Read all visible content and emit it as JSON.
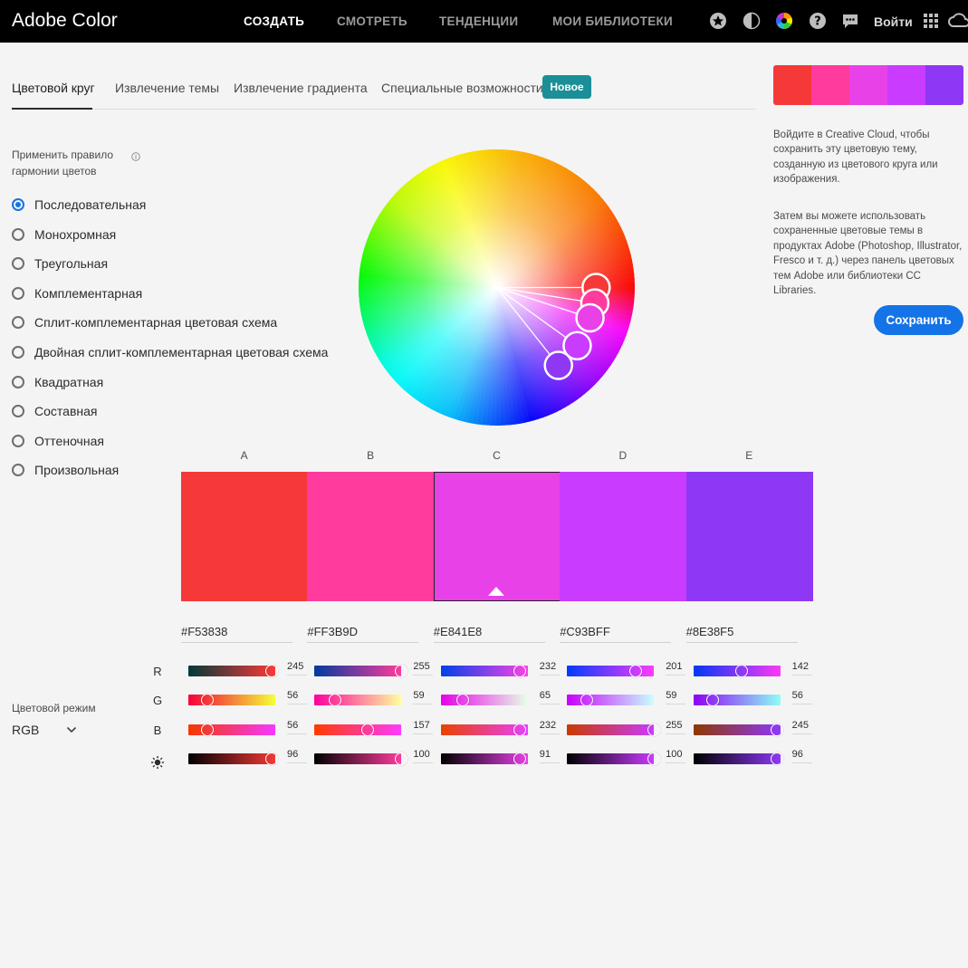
{
  "app": {
    "brand": "Adobe Color"
  },
  "nav": {
    "items": [
      "СОЗДАТЬ",
      "СМОТРЕТЬ",
      "ТЕНДЕНЦИИ",
      "МОИ БИБЛИОТЕКИ"
    ],
    "icons": [
      "star-icon",
      "contrast-icon",
      "color-wheel-icon",
      "help-icon",
      "feedback-icon"
    ],
    "login": "Войти"
  },
  "tabs": {
    "items": [
      "Цветовой круг",
      "Извлечение темы",
      "Извлечение градиента",
      "Специальные возможности"
    ],
    "badge": "Новое"
  },
  "harmony": {
    "title": "Применить правило гармонии цветов",
    "selected": 0,
    "options": [
      "Последовательная",
      "Монохромная",
      "Треугольная",
      "Комплементарная",
      "Сплит-комплементарная цветовая схема",
      "Двойная сплит-комплементарная цветовая схема",
      "Квадратная",
      "Составная",
      "Оттеночная",
      "Произвольная"
    ]
  },
  "swatches": [
    {
      "letter": "A",
      "hex": "#F53838",
      "color": "#F53838",
      "r": "245",
      "g": "56",
      "b": "56",
      "br": "96"
    },
    {
      "letter": "B",
      "hex": "#FF3B9D",
      "color": "#FF3B9D",
      "r": "255",
      "g": "59",
      "b": "157",
      "br": "100"
    },
    {
      "letter": "C",
      "hex": "#E841E8",
      "color": "#E841E8",
      "r": "232",
      "g": "65",
      "b": "232",
      "br": "91"
    },
    {
      "letter": "D",
      "hex": "#C93BFF",
      "color": "#C93BFF",
      "r": "201",
      "g": "59",
      "b": "255",
      "br": "100"
    },
    {
      "letter": "E",
      "hex": "#8E38F5",
      "color": "#8E38F5",
      "r": "142",
      "g": "56",
      "b": "245",
      "br": "96"
    }
  ],
  "selected_swatch": 2,
  "channels": [
    "R",
    "G",
    "B"
  ],
  "brightness_icon": "sun-icon",
  "color_mode": {
    "title": "Цветовой режим",
    "value": "RGB"
  },
  "side_panel": {
    "text1": "Войдите в Creative Cloud, чтобы сохранить эту цветовую тему, созданную из цветового круга или изображения.",
    "text2": "Затем вы можете использовать сохраненные цветовые темы в продуктах Adobe (Photoshop, Illustrator, Fresco и т. д.) через панель цветовых тем Adobe или библиотеки CC Libraries.",
    "save": "Сохранить"
  }
}
